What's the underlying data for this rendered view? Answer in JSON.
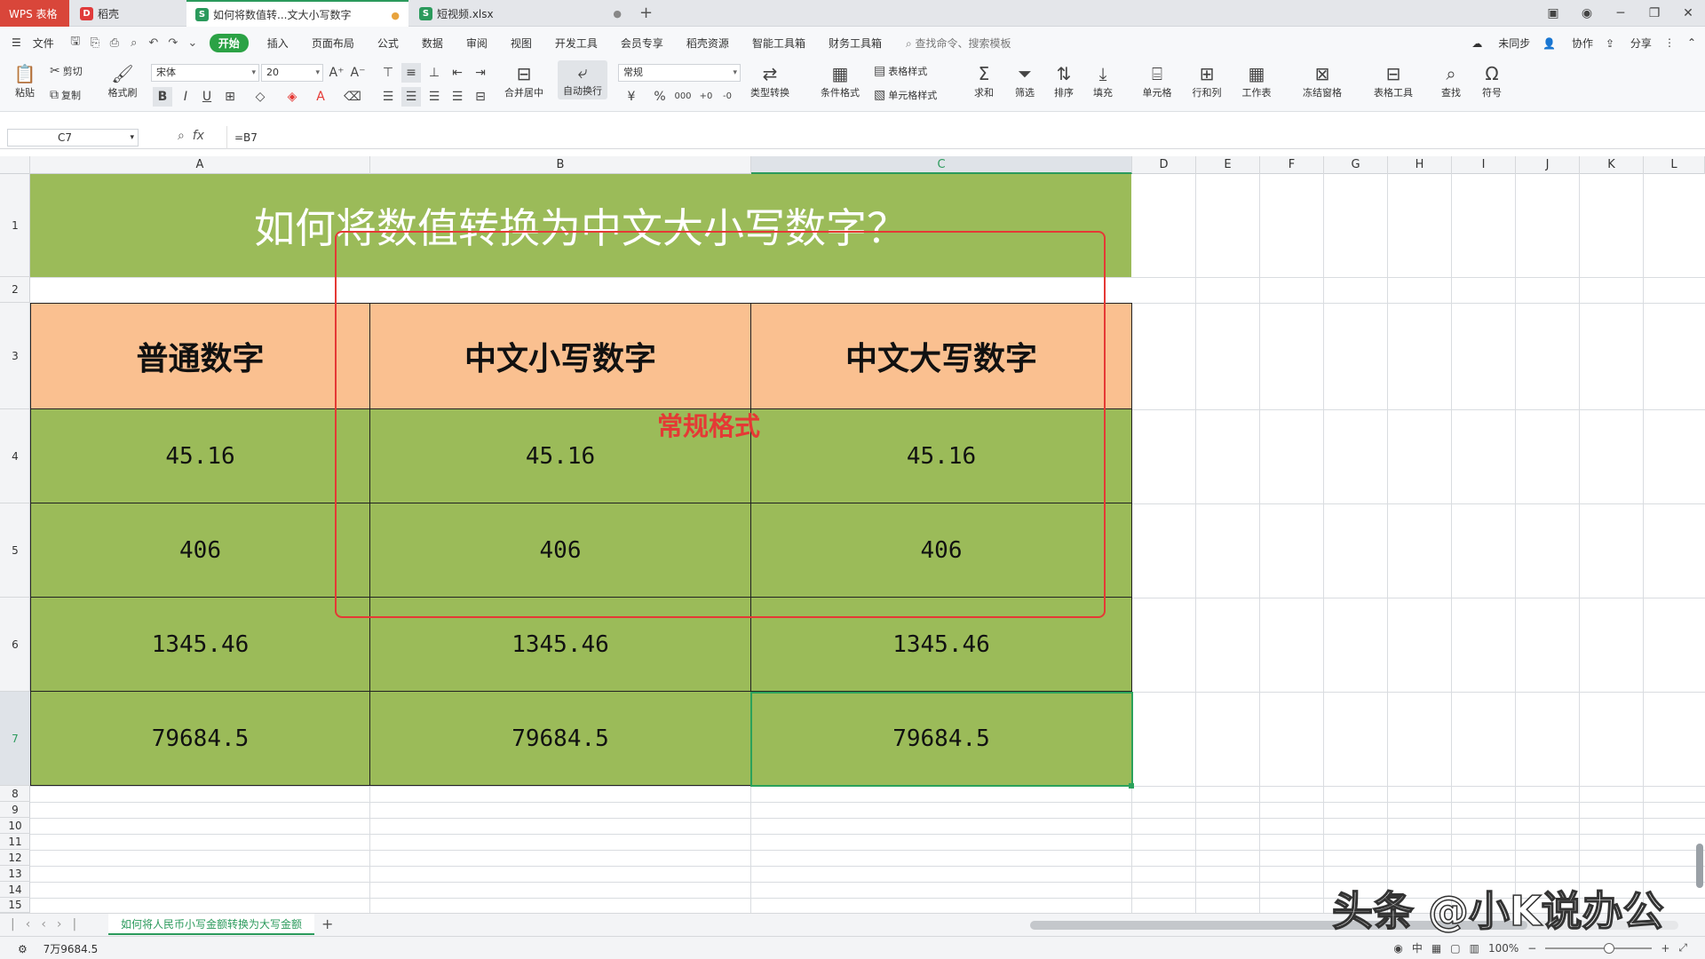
{
  "tabs": {
    "wps": "WPS 表格",
    "daoke": "稻壳",
    "doc1": "如何将数值转...文大小写数字",
    "doc2": "短视频.xlsx"
  },
  "menu": {
    "file": "文件",
    "items": [
      "开始",
      "插入",
      "页面布局",
      "公式",
      "数据",
      "审阅",
      "视图",
      "开发工具",
      "会员专享",
      "稻壳资源",
      "智能工具箱",
      "财务工具箱"
    ],
    "search": "查找命令、搜索模板",
    "sync": "未同步",
    "collab": "协作",
    "share": "分享"
  },
  "toolbar": {
    "paste": "粘贴",
    "cut": "剪切",
    "copy": "复制",
    "format_painter": "格式刷",
    "font_name": "宋体",
    "font_size": "20",
    "merge": "合并居中",
    "wrap": "自动换行",
    "number_format": "常规",
    "type_convert": "类型转换",
    "cond_format": "条件格式",
    "table_style": "表格样式",
    "cell_style": "单元格样式",
    "sum": "求和",
    "filter": "筛选",
    "sort": "排序",
    "fill": "填充",
    "cell": "单元格",
    "row_col": "行和列",
    "worksheet": "工作表",
    "freeze": "冻结窗格",
    "table_tools": "表格工具",
    "find": "查找",
    "symbol": "符号"
  },
  "formula_bar": {
    "name_box": "C7",
    "formula": "=B7"
  },
  "columns": [
    "A",
    "B",
    "C",
    "D",
    "E",
    "F",
    "G",
    "H",
    "I",
    "J",
    "K",
    "L"
  ],
  "rows": [
    "1",
    "2",
    "3",
    "4",
    "5",
    "6",
    "7",
    "8",
    "9",
    "10",
    "11",
    "12",
    "13",
    "14",
    "15"
  ],
  "sheet": {
    "title": "如何将数值转换为中文大小写数字？",
    "headers": [
      "普通数字",
      "中文小写数字",
      "中文大写数字"
    ],
    "data": [
      [
        "45.16",
        "45.16",
        "45.16"
      ],
      [
        "406",
        "406",
        "406"
      ],
      [
        "1345.46",
        "1345.46",
        "1345.46"
      ],
      [
        "79684.5",
        "79684.5",
        "79684.5"
      ]
    ],
    "annotation": "常规格式"
  },
  "sheet_tab": "如何将人民币小写金额转换为大写金额",
  "status": {
    "value": "7万9684.5",
    "zoom": "100%"
  },
  "watermark": "头条 @小K说办公",
  "colors": {
    "green": "#9bbb59",
    "orange": "#fac090",
    "red": "#e53935",
    "accent": "#2ba245"
  }
}
